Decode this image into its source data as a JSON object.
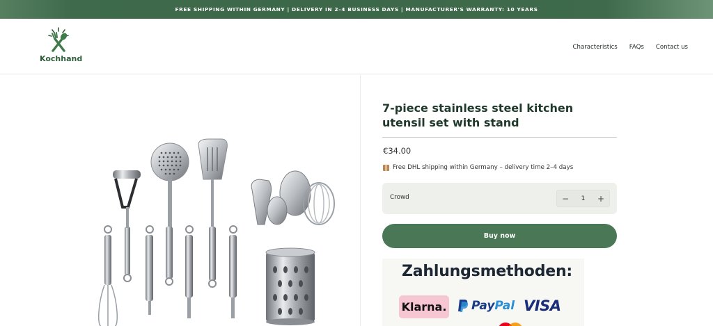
{
  "announcement": {
    "text": "FREE SHIPPING WITHIN GERMANY |  DELIVERY IN 2–4 BUSINESS DAYS |  MANUFACTURER'S WARRANTY: 10 YEARS"
  },
  "header": {
    "logo_text": "Kochhand",
    "logo_icon": "crossed-fork-spoon-icon",
    "nav": [
      {
        "label": "Characteristics"
      },
      {
        "label": "FAQs"
      },
      {
        "label": "Contact us"
      }
    ]
  },
  "gallery": {
    "image": "kitchen-utensil-set-photo"
  },
  "product": {
    "title": "7-piece stainless steel kitchen utensil set with stand",
    "price": "€34.00",
    "shipping_icon": "package-icon",
    "shipping_text": "Free DHL shipping within Germany – delivery time 2–4 days",
    "quantity_label": "Crowd",
    "quantity_minus": "−",
    "quantity_value": "1",
    "quantity_plus": "+",
    "buy_label": "Buy now"
  },
  "payment": {
    "heading": "Zahlungsmethoden:",
    "klarna": "Klarna.",
    "paypal_pay": "Pay",
    "paypal_pal": "Pal",
    "visa": "VISA"
  },
  "colors": {
    "brand_green": "#4a7857",
    "banner_green": "#3c6849",
    "klarna_pink": "#f6c6d2",
    "paypal_dark": "#1b3e8a",
    "paypal_light": "#2a8fd6",
    "visa_blue": "#1a2d7a"
  }
}
